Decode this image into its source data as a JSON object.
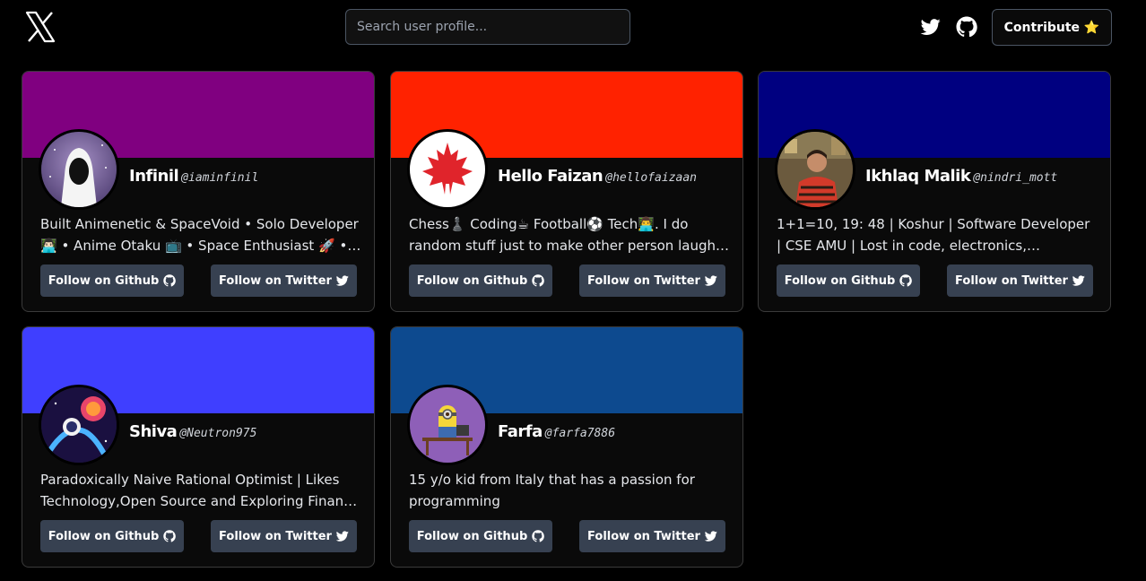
{
  "header": {
    "search_placeholder": "Search user profile...",
    "contribute_label": "Contribute ⭐"
  },
  "icons": {
    "logo": "x-logo-icon",
    "twitter": "twitter-icon",
    "github": "github-icon"
  },
  "buttons": {
    "github_label": "Follow on Github",
    "twitter_label": "Follow on Twitter"
  },
  "profiles": [
    {
      "name": "Infinil",
      "handle": "@iaminfinil",
      "bio": "Built Animenetic & SpaceVoid • Solo Developer 👨🏻‍💻 • Anime Otaku 📺 • Space Enthusiast 🚀 • Creator",
      "banner_color": "#800080"
    },
    {
      "name": "Hello Faizan",
      "handle": "@hellofaizaan",
      "bio": "Chess♟️ Coding☕ Football⚽ Tech👨‍💻. I do random stuff just to make other person laugh. Find me => everywhere",
      "banner_color": "#ff2200"
    },
    {
      "name": "Ikhlaq Malik",
      "handle": "@nindri_mott",
      "bio": "1+1=10, 19: 48 | Koshur | Software Developer | CSE AMU | Lost in code, electronics, machines, and more",
      "banner_color": "#000080"
    },
    {
      "name": "Shiva",
      "handle": "@Neutron975",
      "bio": "Paradoxically Naive Rational Optimist | Likes Technology,Open Source and Exploring Finance and more",
      "banner_color": "#3f3fff"
    },
    {
      "name": "Farfa",
      "handle": "@farfa7886",
      "bio": "15 y/o kid from Italy that has a passion for programming",
      "banner_color": "#0d4a8f"
    }
  ]
}
